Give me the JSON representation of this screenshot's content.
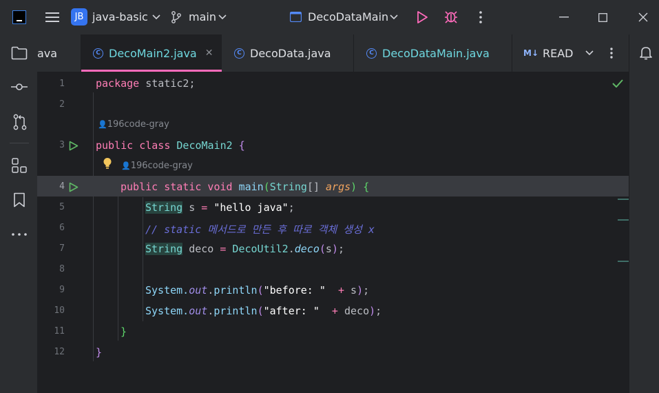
{
  "titlebar": {
    "app_icon": "intellij-icon",
    "project_badge": "JB",
    "project_name": "java-basic",
    "branch": "main",
    "run_config": "DecoDataMain"
  },
  "tabs": [
    {
      "label": "ava",
      "active": false
    },
    {
      "label": "DecoMain2.java",
      "active": true
    },
    {
      "label": "DecoData.java",
      "active": false
    },
    {
      "label": "DecoDataMain.java",
      "active": false
    },
    {
      "label": "READI",
      "active": false,
      "badge": "M↓"
    }
  ],
  "editor": {
    "author_1": "196code-gray",
    "author_2": "196code-gray",
    "line_numbers": [
      "1",
      "2",
      "3",
      "4",
      "5",
      "6",
      "7",
      "8",
      "9",
      "10",
      "11",
      "12"
    ],
    "lines": {
      "l1_kw": "package",
      "l1_rest": " static2;",
      "l3_kw": "public class",
      "l3_cls": " DecoMain2 ",
      "l3_br": "{",
      "l4_kw": "public static void",
      "l4_m": " main",
      "l4_p1": "(",
      "l4_t": "String",
      "l4_arr": "[] ",
      "l4_arg": "args",
      "l4_p2": ")",
      "l4_br": " {",
      "l5_t": "String",
      "l5_a": " s ",
      "l5_op": "=",
      "l5_s": " \"hello java\"",
      "l5_e": ";",
      "l6_c": "// static 메서드로 만든 후 따로 객체 생성 x",
      "l7_t": "String",
      "l7_a": " deco ",
      "l7_op": "=",
      "l7_c": " DecoUtil2",
      "l7_d": ".",
      "l7_m": "deco",
      "l7_p1": "(",
      "l7_v": "s",
      "l7_p2": ")",
      "l7_e": ";",
      "l9_a": "System.",
      "l9_f": "out",
      "l9_b": ".",
      "l9_m": "println",
      "l9_p1": "(",
      "l9_s": "\"before: \"",
      "l9_op": "  + ",
      "l9_v": "s",
      "l9_p2": ")",
      "l9_e": ";",
      "l10_a": "System.",
      "l10_f": "out",
      "l10_b": ".",
      "l10_m": "println",
      "l10_p1": "(",
      "l10_s": "\"after: \"",
      "l10_op": "  + ",
      "l10_v": "deco",
      "l10_p2": ")",
      "l10_e": ";",
      "l11": "}",
      "l12": "}"
    }
  }
}
